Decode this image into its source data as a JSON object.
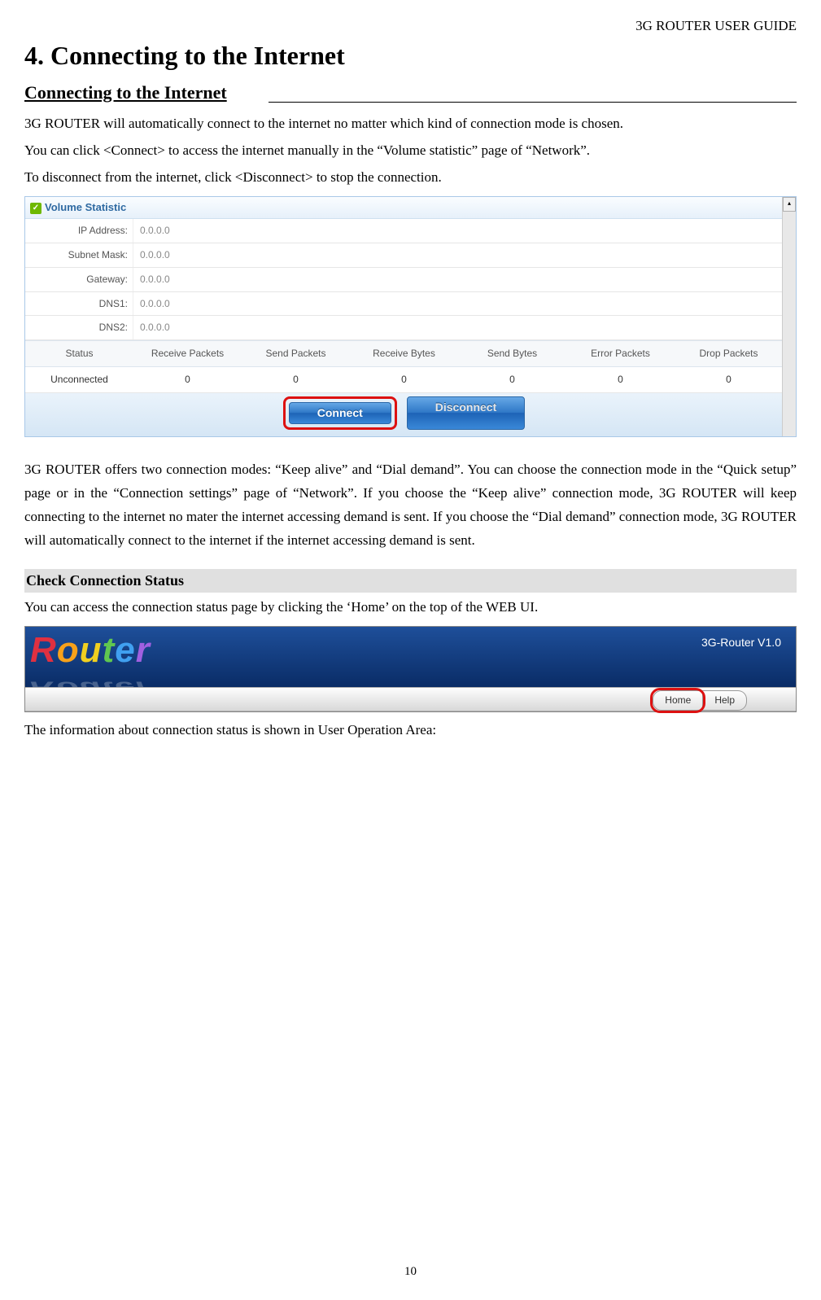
{
  "header": {
    "guide_title": "3G ROUTER USER GUIDE"
  },
  "chapter": {
    "title": "4. Connecting to the Internet"
  },
  "section": {
    "title": "Connecting to the Internet"
  },
  "para1": "3G ROUTER will automatically connect to the internet no matter which kind of connection mode is chosen.",
  "para2": "You can click <Connect> to access the internet manually in the “Volume statistic” page of “Network”.",
  "para3": "To disconnect from the internet, click <Disconnect> to stop the connection.",
  "panel": {
    "title": "Volume Statistic",
    "rows": {
      "ip_label": "IP Address:",
      "ip_value": "0.0.0.0",
      "mask_label": "Subnet Mask:",
      "mask_value": "0.0.0.0",
      "gw_label": "Gateway:",
      "gw_value": "0.0.0.0",
      "dns1_label": "DNS1:",
      "dns1_value": "0.0.0.0",
      "dns2_label": "DNS2:",
      "dns2_value": "0.0.0.0"
    },
    "stats_head": {
      "status": "Status",
      "recv_pkts": "Receive Packets",
      "send_pkts": "Send Packets",
      "recv_bytes": "Receive Bytes",
      "send_bytes": "Send Bytes",
      "err_pkts": "Error Packets",
      "drop_pkts": "Drop Packets"
    },
    "stats_row": {
      "status": "Unconnected",
      "recv_pkts": "0",
      "send_pkts": "0",
      "recv_bytes": "0",
      "send_bytes": "0",
      "err_pkts": "0",
      "drop_pkts": "0"
    },
    "buttons": {
      "connect": "Connect",
      "disconnect": "Disconnect"
    }
  },
  "para4": "3G ROUTER offers two connection modes: “Keep alive” and “Dial demand”. You can choose the connection mode in the “Quick setup” page or in the “Connection settings” page of “Network”. If you choose the “Keep alive” connection mode, 3G ROUTER will keep connecting to the internet no mater the internet accessing demand is sent. If you choose the “Dial demand” connection mode, 3G ROUTER will automatically connect to the internet if the internet accessing demand is sent.",
  "subsection": {
    "title": "Check Connection Status"
  },
  "para5": "You can access the connection status page by clicking the ‘Home’ on the top of the WEB UI.",
  "banner": {
    "version": "3G-Router V1.0",
    "home": "Home",
    "help": "Help"
  },
  "para6": "The information about connection status is shown in User Operation Area:",
  "page_number": "10"
}
